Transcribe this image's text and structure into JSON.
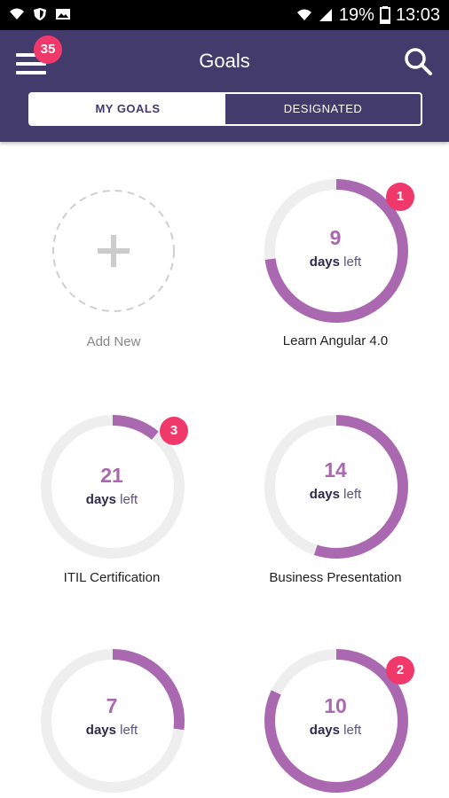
{
  "status_bar": {
    "battery": "19%",
    "time": "13:03",
    "icons": [
      "wifi-icon",
      "shield-icon",
      "image-icon",
      "wifi-icon",
      "signal-icon",
      "battery-icon"
    ]
  },
  "header": {
    "title": "Goals",
    "menu_badge": "35",
    "tabs": [
      {
        "label": "MY GOALS",
        "active": true
      },
      {
        "label": "DESIGNATED",
        "active": false
      }
    ]
  },
  "colors": {
    "header_bg": "#433b6b",
    "ring_fill": "#a968b0",
    "ring_track": "#eeeeee",
    "badge": "#f0386b"
  },
  "add_new": {
    "label": "Add New"
  },
  "goals": [
    {
      "title": "Learn Angular 4.0",
      "days": "9",
      "days_text": "days",
      "left_text": "left",
      "progress": 0.73,
      "badge": "1"
    },
    {
      "title": "ITIL Certification",
      "days": "21",
      "days_text": "days",
      "left_text": "left",
      "progress": 0.11,
      "badge": "3"
    },
    {
      "title": "Business Presentation",
      "days": "14",
      "days_text": "days",
      "left_text": "left",
      "progress": 0.55,
      "badge": ""
    },
    {
      "title": "",
      "days": "7",
      "days_text": "days",
      "left_text": "left",
      "progress": 0.27,
      "badge": ""
    },
    {
      "title": "",
      "days": "10",
      "days_text": "days",
      "left_text": "left",
      "progress": 0.82,
      "badge": "2"
    }
  ]
}
